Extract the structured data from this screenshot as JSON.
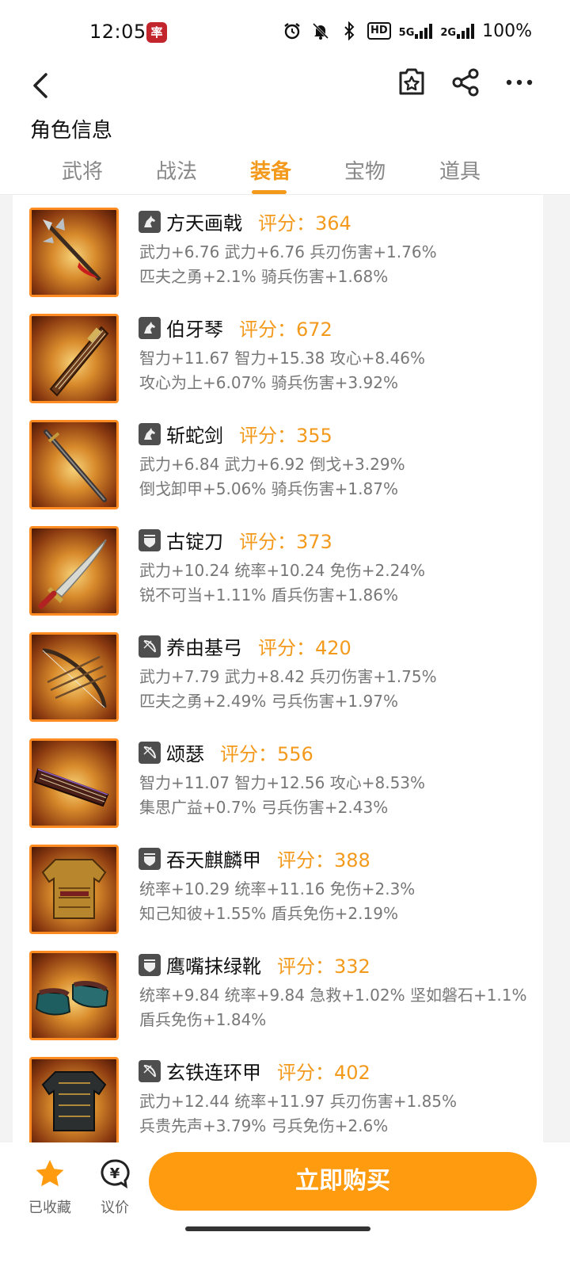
{
  "status_bar": {
    "time": "12:05",
    "app_icon_glyph": "率",
    "hd": "HD",
    "net1": "5G",
    "net2": "2G",
    "battery": "100%"
  },
  "header": {
    "title": "角色信息",
    "tabs": [
      {
        "label": "武将"
      },
      {
        "label": "战法"
      },
      {
        "label": "装备"
      },
      {
        "label": "宝物"
      },
      {
        "label": "道具"
      }
    ],
    "active_tab": "装备",
    "accent_color": "#f39a1d"
  },
  "items": [
    {
      "type_icon": "horse-icon",
      "name": "方天画戟",
      "score": "评分：364",
      "line1": "武力+6.76 武力+6.76 兵刃伤害+1.76%",
      "line2": "匹夫之勇+2.1% 骑兵伤害+1.68%"
    },
    {
      "type_icon": "horse-icon",
      "name": "伯牙琴",
      "score": "评分：672",
      "line1": "智力+11.67 智力+15.38 攻心+8.46%",
      "line2": "攻心为上+6.07% 骑兵伤害+3.92%"
    },
    {
      "type_icon": "horse-icon",
      "name": "斩蛇剑",
      "score": "评分：355",
      "line1": "武力+6.84 武力+6.92 倒戈+3.29%",
      "line2": "倒戈卸甲+5.06% 骑兵伤害+1.87%"
    },
    {
      "type_icon": "shield-icon",
      "name": "古锭刀",
      "score": "评分：373",
      "line1": "武力+10.24 统率+10.24 免伤+2.24%",
      "line2": "锐不可当+1.11% 盾兵伤害+1.86%"
    },
    {
      "type_icon": "bow-icon",
      "name": "养由基弓",
      "score": "评分：420",
      "line1": "武力+7.79 武力+8.42 兵刃伤害+1.75%",
      "line2": "匹夫之勇+2.49% 弓兵伤害+1.97%"
    },
    {
      "type_icon": "bow-icon",
      "name": "颂瑟",
      "score": "评分：556",
      "line1": "智力+11.07 智力+12.56 攻心+8.53%",
      "line2": "集思广益+0.7% 弓兵伤害+2.43%"
    },
    {
      "type_icon": "shield-icon",
      "name": "吞天麒麟甲",
      "score": "评分：388",
      "line1": "统率+10.29 统率+11.16 免伤+2.3%",
      "line2": "知己知彼+1.55% 盾兵免伤+2.19%"
    },
    {
      "type_icon": "shield-icon",
      "name": "鹰嘴抹绿靴",
      "score": "评分：332",
      "line1": "统率+9.84 统率+9.84 急救+1.02% 坚如磐石+1.1%",
      "line2": "盾兵免伤+1.84%"
    },
    {
      "type_icon": "bow-icon",
      "name": "玄铁连环甲",
      "score": "评分：402",
      "line1": "武力+12.44 统率+11.97 兵刃伤害+1.85%",
      "line2": "兵贵先声+3.79% 弓兵免伤+2.6%"
    }
  ],
  "bottom_bar": {
    "favorite_label": "已收藏",
    "bargain_label": "议价",
    "bargain_glyph": "¥",
    "buy_label": "立即购买",
    "buy_color": "#ff9b0f"
  }
}
